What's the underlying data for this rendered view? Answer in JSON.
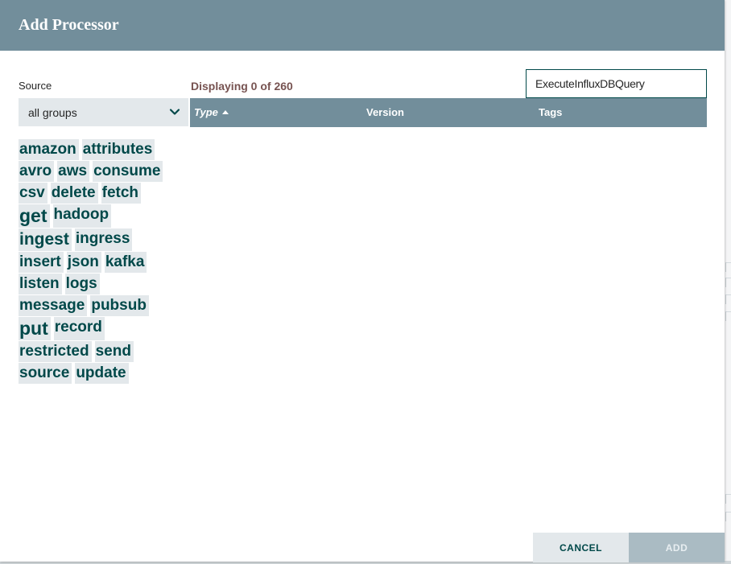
{
  "dialog": {
    "title": "Add Processor"
  },
  "source": {
    "label": "Source",
    "selected": "all groups"
  },
  "results": {
    "count_text": "Displaying 0 of 260"
  },
  "filter": {
    "value": "ExecuteInfluxDBQuery"
  },
  "table": {
    "columns": [
      "Type",
      "Version",
      "Tags"
    ],
    "rows": []
  },
  "tag_cloud": [
    [
      "amazon",
      "attributes"
    ],
    [
      "avro",
      "aws",
      "consume"
    ],
    [
      "csv",
      "delete",
      "fetch"
    ],
    [
      "get",
      "hadoop"
    ],
    [
      "ingest",
      "ingress"
    ],
    [
      "insert",
      "json",
      "kafka"
    ],
    [
      "listen",
      "logs"
    ],
    [
      "message",
      "pubsub"
    ],
    [
      "put",
      "record"
    ],
    [
      "restricted",
      "send"
    ],
    [
      "source",
      "update"
    ]
  ],
  "buttons": {
    "cancel": "CANCEL",
    "add": "ADD"
  },
  "colors": {
    "header": "#728e9b",
    "accent": "#004849",
    "tag_bg": "#e3e8eb",
    "count_text": "#775351"
  },
  "icons": {
    "select_chevron": "chevron-down-icon",
    "sort_indicator": "sort-ascending-icon"
  }
}
